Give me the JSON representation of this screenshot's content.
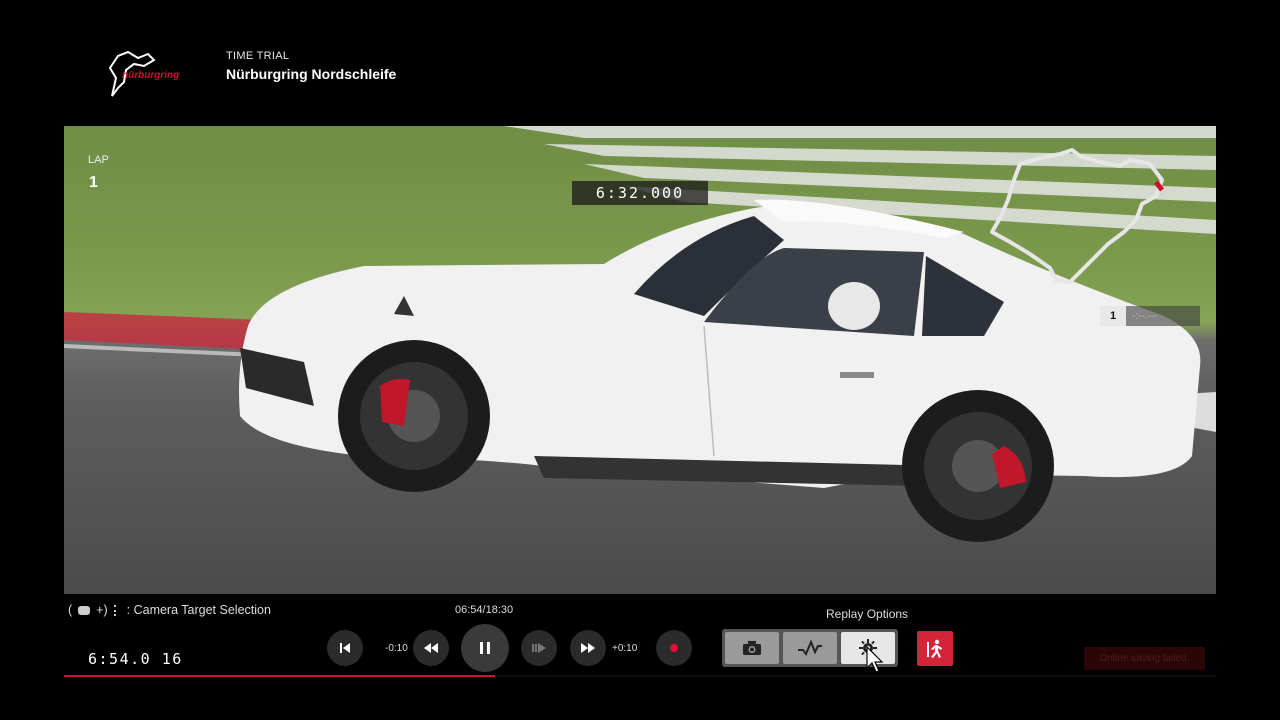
{
  "header": {
    "logo_text": "nürburgring",
    "mode": "TIME TRIAL",
    "track": "Nürburgring Nordschleife"
  },
  "hud": {
    "lap_label": "LAP",
    "lap_value": "1",
    "lap_time": "6:32.000",
    "position": "1",
    "position_time": "-:--.---"
  },
  "replay": {
    "hint_text": ": Camera Target Selection",
    "hint_prefix": "(",
    "hint_plus": "+)",
    "time_position": "06:54/18:30",
    "clock": "6:54.0 16",
    "progress": 0.374,
    "rewind_label": "-0:10",
    "forward_label": "+0:10",
    "options_label": "Replay Options",
    "save_status": "Online saving failed."
  },
  "colors": {
    "accent_red": "#d0102a",
    "exit_red": "#d4243a"
  },
  "icons": {
    "skip_start": "skip-start-icon",
    "rewind": "rewind-icon",
    "pause": "pause-icon",
    "step": "step-forward-icon",
    "fast_forward": "fast-forward-icon",
    "record": "record-icon",
    "camera": "camera-icon",
    "graph": "telemetry-graph-icon",
    "settings": "gear-icon",
    "exit": "exit-runner-icon"
  }
}
